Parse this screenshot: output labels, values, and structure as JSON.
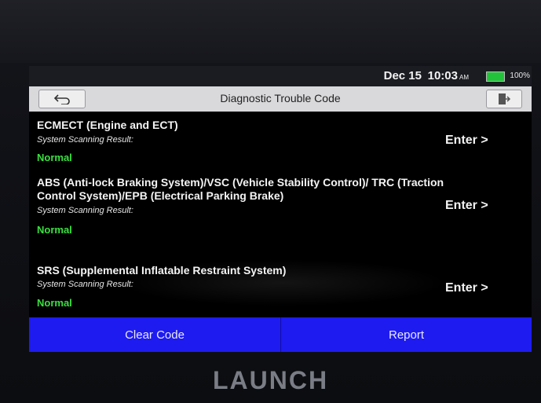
{
  "status_bar": {
    "date": "Dec 15",
    "time": "10:03",
    "ampm": "AM",
    "battery": "100%"
  },
  "header": {
    "title": "Diagnostic Trouble Code"
  },
  "icons": {
    "back": "back-arrow-icon",
    "exit": "exit-icon",
    "battery": "battery-icon"
  },
  "colors": {
    "status_normal": "#39e03f",
    "bottom_bar": "#1e1bf0",
    "battery": "#22c23a"
  },
  "systems": [
    {
      "title": "ECMECT (Engine and ECT)",
      "result_label": "System Scanning Result:",
      "status": "Normal",
      "action": "Enter >"
    },
    {
      "title": "ABS (Anti-lock Braking System)/VSC (Vehicle Stability Control)/ TRC (Traction Control System)/EPB (Electrical Parking Brake)",
      "result_label": "System Scanning Result:",
      "status": "Normal",
      "action": "Enter >"
    },
    {
      "title": "SRS (Supplemental Inflatable Restraint System)",
      "result_label": "System Scanning Result:",
      "status": "Normal",
      "action": "Enter >"
    }
  ],
  "footer": {
    "clear_label": "Clear Code",
    "report_label": "Report"
  },
  "device": {
    "brand": "LAUNCH"
  }
}
